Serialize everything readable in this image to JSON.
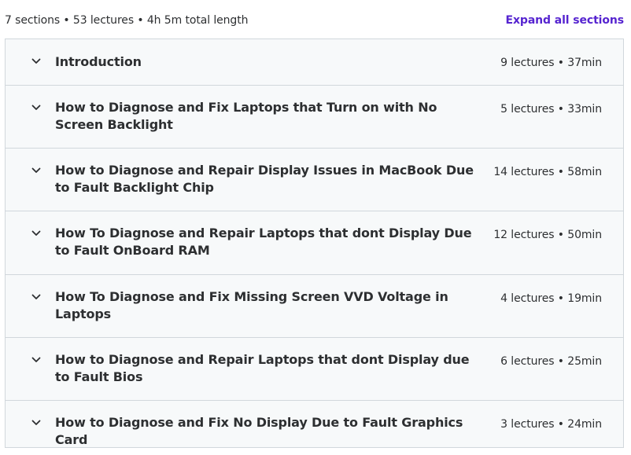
{
  "curriculum": {
    "summary": "7 sections • 53 lectures • 4h 5m total length",
    "expand_label": "Expand all sections"
  },
  "icons": {
    "chevron": "chevron-down-icon"
  },
  "colors": {
    "accent": "#5624d0",
    "section_bg": "#f7f9fa",
    "border": "#d1d7dc",
    "text": "#2d2f31"
  },
  "sections": [
    {
      "title": "Introduction",
      "meta": "9 lectures • 37min"
    },
    {
      "title": "How to Diagnose and Fix Laptops that Turn on with No Screen Backlight",
      "meta": "5 lectures • 33min"
    },
    {
      "title": "How to Diagnose and Repair Display Issues in MacBook Due to Fault Backlight Chip",
      "meta": "14 lectures • 58min"
    },
    {
      "title": "How To Diagnose and Repair Laptops that dont Display Due to Fault OnBoard RAM",
      "meta": "12 lectures • 50min"
    },
    {
      "title": "How To Diagnose and Fix Missing Screen VVD Voltage in Laptops",
      "meta": "4 lectures • 19min"
    },
    {
      "title": "How to Diagnose and Repair Laptops that dont Display due to Fault Bios",
      "meta": "6 lectures • 25min"
    },
    {
      "title": "How to Diagnose and Fix No Display Due to Fault Graphics Card",
      "meta": "3 lectures • 24min"
    }
  ]
}
